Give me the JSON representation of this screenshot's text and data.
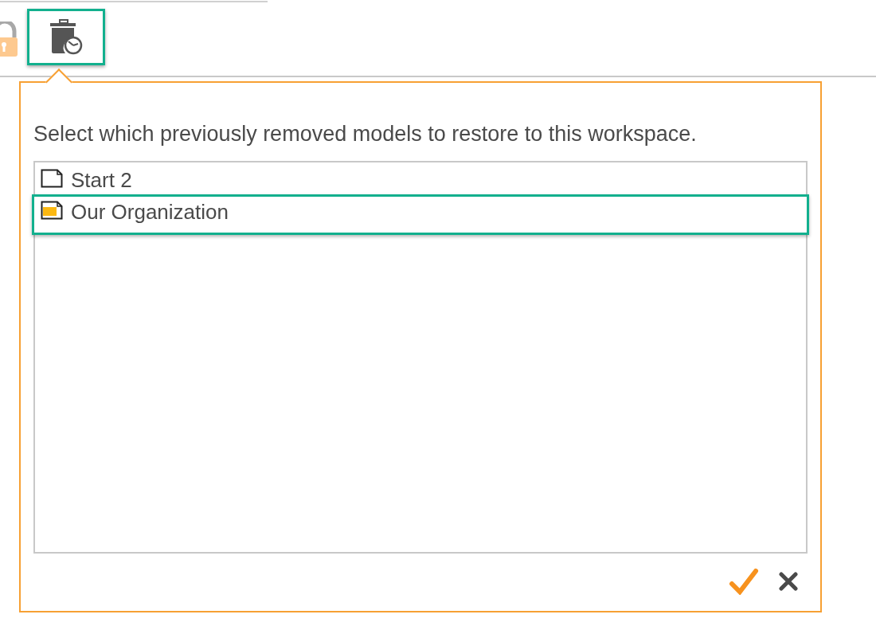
{
  "toolbar": {
    "buttons": [
      {
        "kind": "lock",
        "selected": false
      },
      {
        "kind": "restore",
        "selected": true
      }
    ]
  },
  "dialog": {
    "prompt": "Select which previously removed models to restore to this workspace.",
    "items": [
      {
        "label": "Start 2",
        "kind": "blank",
        "selected": false
      },
      {
        "label": "Our Organization",
        "kind": "filled",
        "selected": true
      }
    ]
  }
}
